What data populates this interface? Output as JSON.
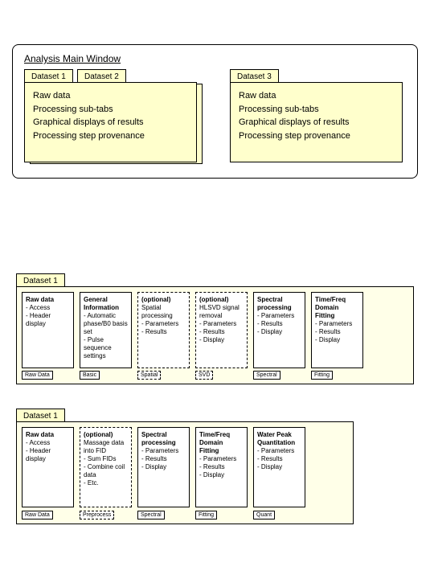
{
  "main": {
    "title": "Analysis Main Window",
    "tabs": {
      "t1": "Dataset 1",
      "t2": "Dataset 2",
      "t3": "Dataset 3"
    },
    "left_body": "Raw data\nProcessing sub-tabs\nGraphical displays of results\nProcessing step provenance",
    "right_body": "Raw data\nProcessing sub-tabs\nGraphical displays of results\nProcessing step provenance"
  },
  "sec2": {
    "tab": "Dataset 1",
    "boxes": [
      {
        "title": "Raw data",
        "lines": "- Access\n- Header display",
        "tab": "Raw Data",
        "dashed": false
      },
      {
        "title": "General Information",
        "lines": "- Automatic phase/B0 basis set\n- Pulse sequence settings",
        "tab": "Basic",
        "dashed": false
      },
      {
        "title": "(optional)",
        "lines": "Spatial processing\n- Parameters\n- Results",
        "tab": "Spatial",
        "dashed": true
      },
      {
        "title": "(optional)",
        "lines": "HLSVD signal removal\n- Parameters\n- Results\n- Display",
        "tab": "SVD",
        "dashed": true
      },
      {
        "title": "Spectral processing",
        "lines": "- Parameters\n- Results\n- Display",
        "tab": "Spectral",
        "dashed": false
      },
      {
        "title": "Time/Freq Domain Fitting",
        "lines": "- Parameters\n- Results\n- Display",
        "tab": "Fitting",
        "dashed": false
      }
    ]
  },
  "sec3": {
    "tab": "Dataset 1",
    "boxes": [
      {
        "title": "Raw data",
        "lines": "- Access\n- Header display",
        "tab": "Raw Data",
        "dashed": false
      },
      {
        "title": "(optional)",
        "lines": "Massage data into FID\n- Sum FIDs\n- Combine coil data\n- Etc.",
        "tab": "Preprocess",
        "dashed": true
      },
      {
        "title": "Spectral processing",
        "lines": "- Parameters\n- Results\n- Display",
        "tab": "Spectral",
        "dashed": false
      },
      {
        "title": "Time/Freq Domain Fitting",
        "lines": "- Parameters\n- Results\n- Display",
        "tab": "Fitting",
        "dashed": false
      },
      {
        "title": "Water Peak Quantitation",
        "lines": "- Parameters\n- Results\n- Display",
        "tab": "Quant",
        "dashed": false
      }
    ]
  }
}
